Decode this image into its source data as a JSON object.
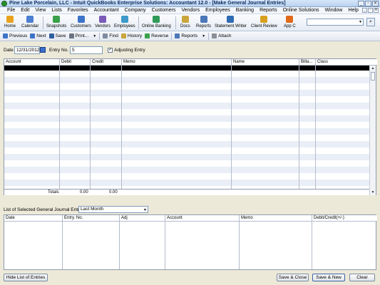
{
  "window": {
    "title": "Pine Lake Porcelain, LLC  - Intuit QuickBooks Enterprise Solutions: Accountant 12.0 - [Make General Journal Entries]",
    "buttons": [
      "_",
      "▫",
      "✕"
    ]
  },
  "menubar": {
    "items": [
      "File",
      "Edit",
      "View",
      "Lists",
      "Favorites",
      "Accountant",
      "Company",
      "Customers",
      "Vendors",
      "Employees",
      "Banking",
      "Reports",
      "Online Solutions",
      "Window",
      "Help"
    ],
    "mdi_buttons": [
      "_",
      "▫",
      "✕"
    ]
  },
  "icon_toolbar": {
    "items": [
      {
        "label": "Home",
        "icon": "house-icon",
        "color": "#e9a21f"
      },
      {
        "label": "Calendar",
        "icon": "calendar-icon",
        "color": "#4a7fd1"
      },
      {
        "label": "Snapshots",
        "icon": "snapshot-icon",
        "color": "#3aa14a"
      },
      {
        "label": "Customers",
        "icon": "customers-icon",
        "color": "#3d73c9"
      },
      {
        "label": "Vendors",
        "icon": "vendors-icon",
        "color": "#7a5bb8"
      },
      {
        "label": "Employees",
        "icon": "employees-icon",
        "color": "#3d9ac9"
      },
      {
        "label": "Online Banking",
        "icon": "online-banking-icon",
        "color": "#2f9a58"
      },
      {
        "label": "Docs",
        "icon": "docs-icon",
        "color": "#c9a53d"
      },
      {
        "label": "Reports",
        "icon": "reports-icon",
        "color": "#4c78b8"
      },
      {
        "label": "Statement Writer",
        "icon": "statement-writer-icon",
        "color": "#2d6bb3"
      },
      {
        "label": "Client Review",
        "icon": "client-review-icon",
        "color": "#d9a020"
      },
      {
        "label": "App C",
        "icon": "app-center-icon",
        "color": "#e06a1a"
      }
    ],
    "search_placeholder": ""
  },
  "form_toolbar": {
    "previous": "Previous",
    "next": "Next",
    "save": "Save",
    "print": "Print...",
    "find": "Find",
    "history": "History",
    "reverse": "Reverse",
    "reports": "Reports",
    "attach": "Attach"
  },
  "header": {
    "date_label": "Date",
    "date_value": "12/31/2012",
    "entry_no_label": "Entry No.",
    "entry_no_value": "5",
    "adjusting_label": "Adjusting Entry",
    "adjusting_checked": true,
    "check_mark": "✓"
  },
  "entry_grid": {
    "columns": [
      "Account",
      "Debit",
      "Credit",
      "Memo",
      "Name",
      "Billa...",
      "Class"
    ],
    "totals_label": "Totals",
    "debit_total": "0.00",
    "credit_total": "0.00"
  },
  "list_section": {
    "label": "List of Selected General Journal Entries:",
    "period_value": "Last Month",
    "columns": [
      "Date",
      "Entry. No.",
      "Adj",
      "Account",
      "Memo",
      "Debit/Credit(+/-)"
    ]
  },
  "buttons": {
    "hide_list": "Hide List of Entries",
    "save_close": "Save & Close",
    "save_new": "Save & New",
    "clear": "Clear"
  },
  "colors": {
    "selected_row": "#000000",
    "stripe": "#e9eef7",
    "window_bg": "#ece9d8"
  }
}
